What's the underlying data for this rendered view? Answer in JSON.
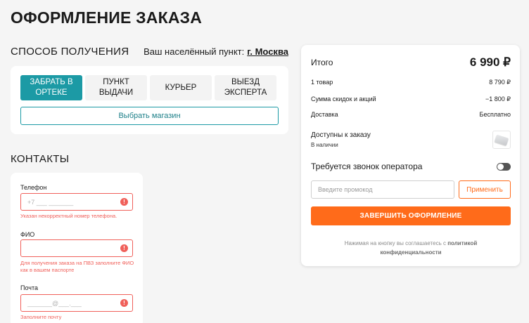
{
  "page": {
    "title": "ОФОРМЛЕНИЕ ЗАКАЗА"
  },
  "delivery": {
    "title": "СПОСОБ ПОЛУЧЕНИЯ",
    "city_prefix": "Ваш населённый пункт:",
    "city": "г. Москва",
    "tabs": [
      {
        "label": "ЗАБРАТЬ В\nОРТЕКЕ",
        "active": true
      },
      {
        "label": "ПУНКТ\nВЫДАЧИ",
        "active": false
      },
      {
        "label": "КУРЬЕР",
        "active": false
      },
      {
        "label": "ВЫЕЗД\nЭКСПЕРТА",
        "active": false
      }
    ],
    "choose_store": "Выбрать магазин"
  },
  "contacts": {
    "title": "КОНТАКТЫ",
    "phone": {
      "label": "Телефон",
      "placeholder": "+7 ___ _______",
      "error": "Указан некорректный номер телефона."
    },
    "name": {
      "label": "ФИО",
      "placeholder": "",
      "error": "Для получения заказа на ПВЗ заполните ФИО как в вашем паспорте"
    },
    "email": {
      "label": "Почта",
      "placeholder": "_______@___.___",
      "error": "Заполните почту"
    },
    "error_icon": "exclamation-icon"
  },
  "summary": {
    "total_label": "Итого",
    "total_value": "6 990 ₽",
    "items_label": "1 товар",
    "items_value": "8 790 ₽",
    "discount_label": "Сумма скидок и акций",
    "discount_value": "−1 800 ₽",
    "delivery_label": "Доставка",
    "delivery_value": "Бесплатно",
    "available_title": "Доступны к заказу",
    "available_sub": "В наличии",
    "operator_label": "Требуется звонок оператора",
    "operator_toggle_on": false,
    "promo_placeholder": "Введите промокод",
    "apply_label": "Применить",
    "finish_label": "ЗАВЕРШИТЬ ОФОРМЛЕНИЕ",
    "legal_text": "Нажимая на кнопку вы соглашаетесь с",
    "legal_link": "политикой конфиденциальности"
  },
  "colors": {
    "accent": "#1c9aa5",
    "primary": "#ff6b1a",
    "error": "#f0605a"
  }
}
